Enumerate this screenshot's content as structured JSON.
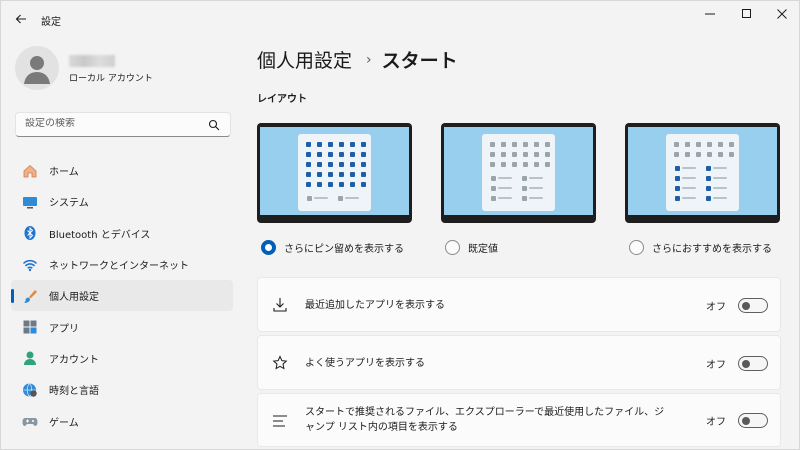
{
  "window": {
    "app_title": "設定",
    "controls": {
      "minimize_icon": "minimize-icon",
      "maximize_icon": "maximize-icon",
      "close_icon": "close-icon"
    }
  },
  "profile": {
    "account_type": "ローカル アカウント"
  },
  "search": {
    "placeholder": "設定の検索"
  },
  "sidebar": {
    "items": [
      {
        "label": "ホーム",
        "icon": "home-icon",
        "active": false
      },
      {
        "label": "システム",
        "icon": "system-icon",
        "active": false
      },
      {
        "label": "Bluetooth とデバイス",
        "icon": "bluetooth-icon",
        "active": false
      },
      {
        "label": "ネットワークとインターネット",
        "icon": "wifi-icon",
        "active": false
      },
      {
        "label": "個人用設定",
        "icon": "brush-icon",
        "active": true
      },
      {
        "label": "アプリ",
        "icon": "apps-icon",
        "active": false
      },
      {
        "label": "アカウント",
        "icon": "account-icon",
        "active": false
      },
      {
        "label": "時刻と言語",
        "icon": "globe-clock-icon",
        "active": false
      },
      {
        "label": "ゲーム",
        "icon": "gamepad-icon",
        "active": false
      }
    ]
  },
  "header": {
    "parent": "個人用設定",
    "separator": "›",
    "current": "スタート"
  },
  "layout": {
    "title": "レイアウト",
    "options": [
      {
        "label": "さらにピン留めを表示する",
        "selected": true
      },
      {
        "label": "既定値",
        "selected": false
      },
      {
        "label": "さらにおすすめを表示する",
        "selected": false
      }
    ]
  },
  "settings": [
    {
      "label": "最近追加したアプリを表示する",
      "icon": "download-icon",
      "state": "オフ"
    },
    {
      "label": "よく使うアプリを表示する",
      "icon": "star-icon",
      "state": "オフ"
    },
    {
      "label": "スタートで推奨されるファイル、エクスプローラーで最近使用したファイル、ジャンプ リスト内の項目を表示する",
      "icon": "list-icon",
      "state": "オフ"
    }
  ],
  "colors": {
    "accent": "#005fb8",
    "tile_pinned": "#1f5fa8",
    "tile_grey": "#9aa4aa",
    "screen_bg": "#99cfee"
  }
}
